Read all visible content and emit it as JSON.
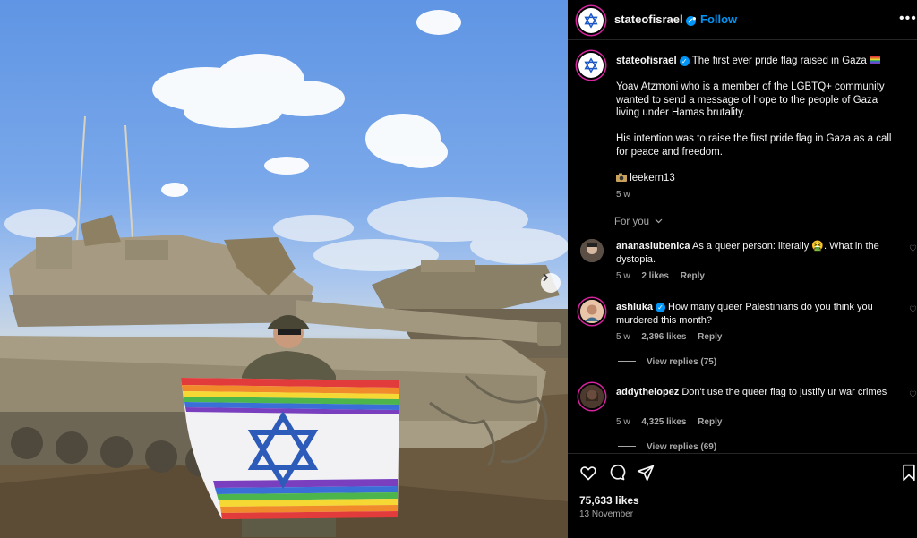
{
  "post": {
    "username": "stateofisrael",
    "follow_label": "Follow",
    "separator": "•",
    "more_label": "•••",
    "caption_title": "The first ever pride flag raised in Gaza",
    "caption_para1": "Yoav Atzmoni who is a member of the LGBTQ+ community wanted to send a message of hope to the people of Gaza living under Hamas brutality.",
    "caption_para2": "His intention was to raise the first pride flag in Gaza as a call for peace and freedom.",
    "credit": "leekern13",
    "age": "5 w",
    "for_you": "For you",
    "likes": "75,633 likes",
    "date": "13 November"
  },
  "comments": [
    {
      "username": "ananaslubenica",
      "verified": false,
      "text": "As a queer person: literally 🤮. What in the dystopia.",
      "age": "5 w",
      "likes": "2 likes",
      "reply": "Reply"
    },
    {
      "username": "ashluka",
      "verified": true,
      "text": "How many queer Palestinians do you think you murdered this month?",
      "age": "5 w",
      "likes": "2,396 likes",
      "reply": "Reply",
      "view_replies": "View replies (75)"
    },
    {
      "username": "addythelopez",
      "verified": false,
      "text": "Don't use the queer flag to justify ur war crimes",
      "age": "5 w",
      "likes": "4,325 likes",
      "reply": "Reply",
      "view_replies": "View replies (69)"
    }
  ],
  "colors": {
    "accent": "#0095f6",
    "background": "#000000",
    "muted": "#a8a8a8"
  },
  "icons": [
    "star-of-david-icon",
    "verified-badge-icon",
    "more-options-icon",
    "heart-icon",
    "comment-icon",
    "share-icon",
    "bookmark-icon",
    "chevron-down-icon",
    "chevron-right-icon",
    "camera-icon"
  ]
}
